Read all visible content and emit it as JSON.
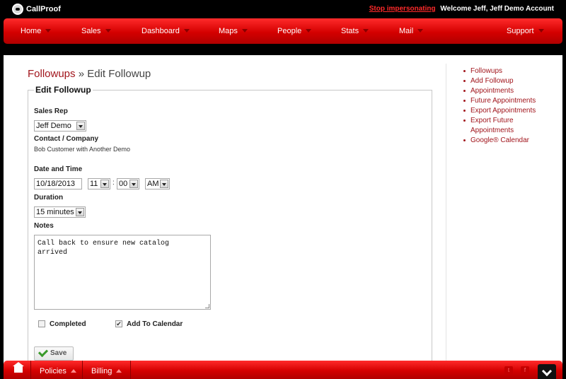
{
  "header": {
    "brand": "CallProof",
    "stop_impersonating": "Stop impersonating",
    "welcome": "Welcome Jeff, Jeff Demo Account"
  },
  "nav": {
    "items": [
      "Home",
      "Sales",
      "Dashboard",
      "Maps",
      "People",
      "Stats",
      "Mail",
      "Support"
    ]
  },
  "breadcrumb": {
    "parent": "Followups",
    "separator": "»",
    "current": "Edit Followup"
  },
  "form": {
    "legend": "Edit Followup",
    "sales_rep_label": "Sales Rep",
    "sales_rep_value": "Jeff Demo",
    "contact_label": "Contact / Company",
    "contact_value": "Bob Customer with Another Demo",
    "datetime_label": "Date and Time",
    "date_value": "10/18/2013",
    "hour_value": "11",
    "minute_value": "00",
    "ampm_value": "AM",
    "time_separator": ":",
    "duration_label": "Duration",
    "duration_value": "15 minutes",
    "notes_label": "Notes",
    "notes_value": "Call back to ensure new catalog\narrived",
    "completed_label": "Completed",
    "completed_checked": false,
    "calendar_label": "Add To Calendar",
    "calendar_checked": true,
    "save_label": "Save"
  },
  "sidebar": {
    "links": [
      "Followups",
      "Add Followup",
      "Appointments",
      "Future Appointments",
      "Export Appointments",
      "Export Future Appointments",
      "Google® Calendar"
    ]
  },
  "bottom": {
    "policies": "Policies",
    "billing": "Billing",
    "twitter_glyph": "t",
    "facebook_glyph": "f"
  },
  "colors": {
    "accent_red": "#d40000",
    "link_red": "#a1151c"
  }
}
